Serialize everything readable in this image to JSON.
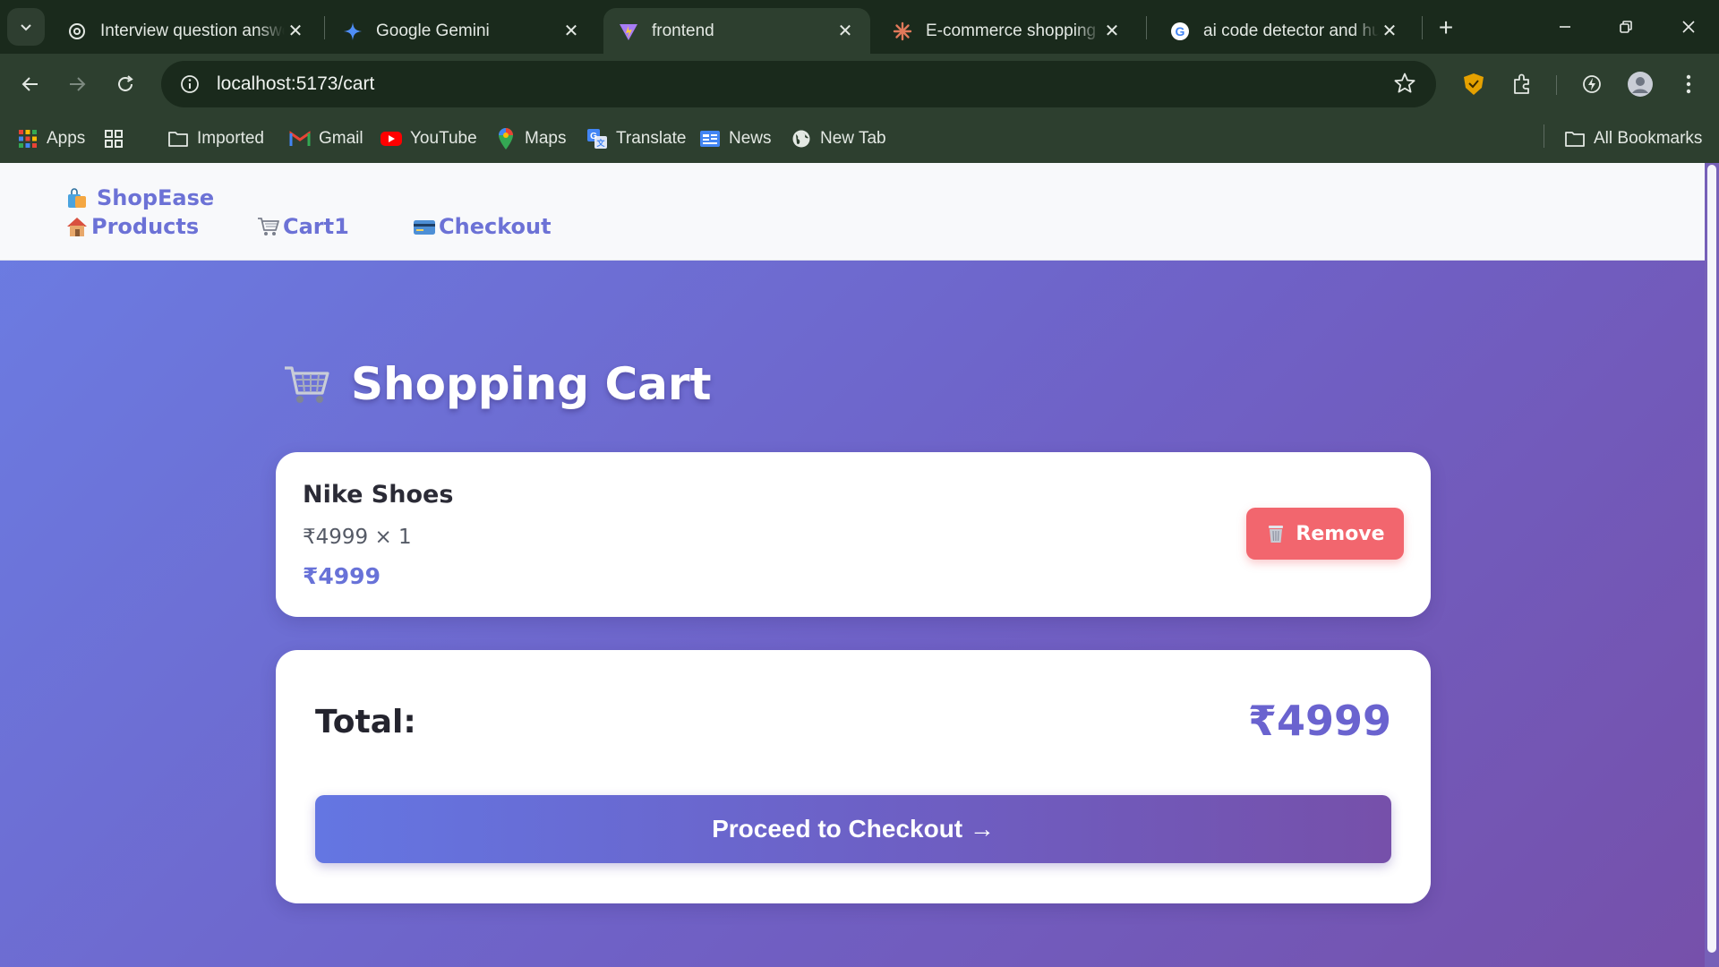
{
  "browser": {
    "tabs": [
      {
        "title": "Interview question answe",
        "active": false,
        "icon": "openai-icon"
      },
      {
        "title": "Google Gemini",
        "active": false,
        "icon": "gemini-icon"
      },
      {
        "title": "frontend",
        "active": true,
        "icon": "vite-icon"
      },
      {
        "title": "E-commerce shopping ca",
        "active": false,
        "icon": "claude-icon"
      },
      {
        "title": "ai code detector and hun",
        "active": false,
        "icon": "google-icon"
      }
    ],
    "url": "localhost:5173/cart",
    "bookmarks": {
      "apps": "Apps",
      "imported": "Imported",
      "gmail": "Gmail",
      "youtube": "YouTube",
      "maps": "Maps",
      "translate": "Translate",
      "news": "News",
      "newtab": "New Tab",
      "all": "All Bookmarks"
    }
  },
  "site": {
    "brand": "ShopEase",
    "nav": {
      "products": "Products",
      "cart": "Cart1",
      "checkout": "Checkout"
    }
  },
  "cart": {
    "title": "Shopping Cart",
    "items": [
      {
        "name": "Nike Shoes",
        "qty_line": "₹4999 × 1",
        "subtotal": "₹4999",
        "remove_label": "Remove"
      }
    ],
    "total_label": "Total:",
    "total_value": "₹4999",
    "checkout_label": "Proceed to Checkout →"
  },
  "colors": {
    "accent": "#6c72d6",
    "remove": "#f2666e",
    "gradient_start": "#6b7de3",
    "gradient_end": "#7650aa"
  }
}
